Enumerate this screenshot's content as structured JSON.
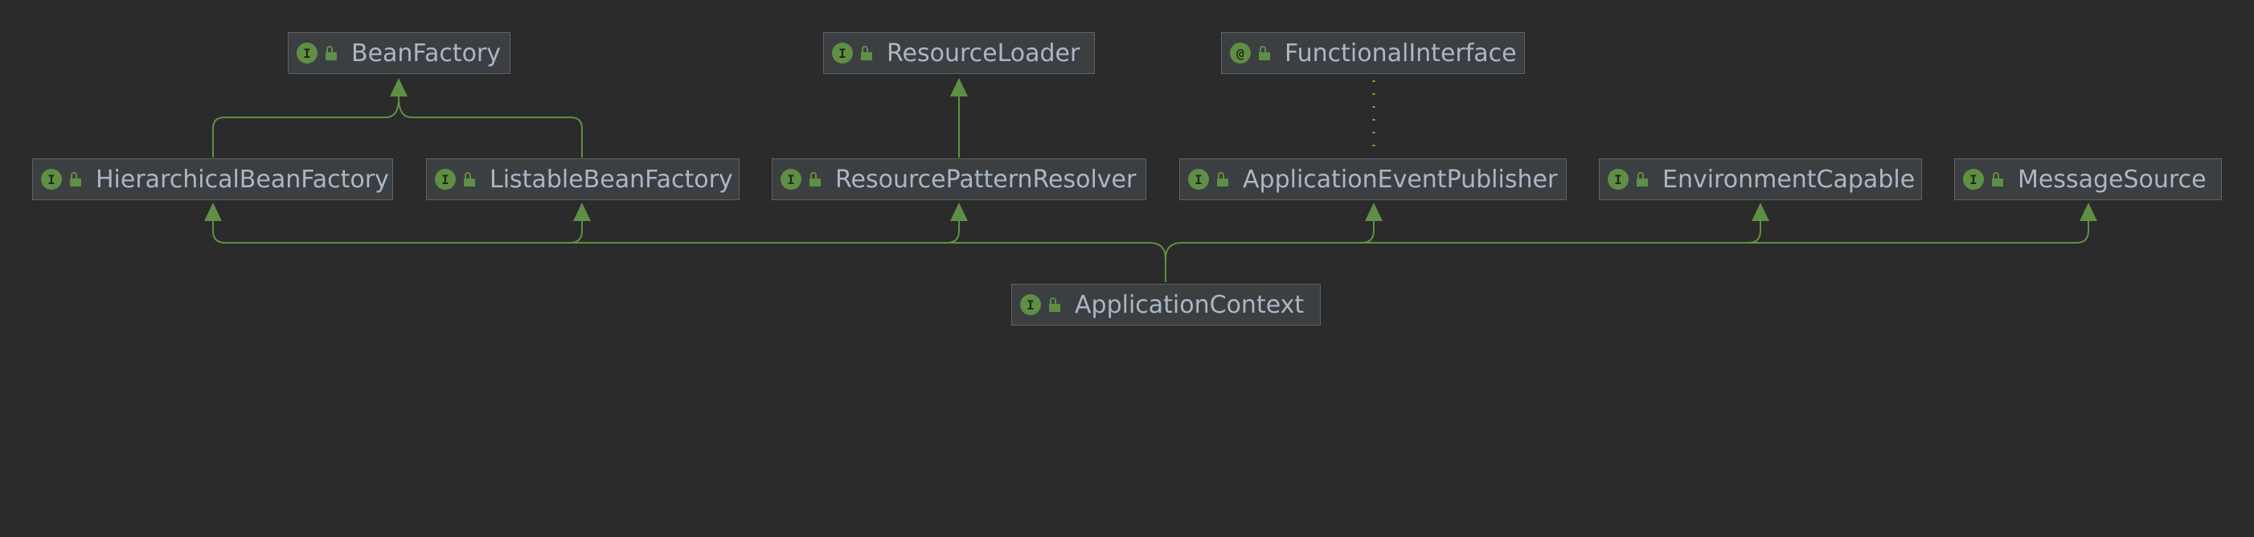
{
  "diagram": {
    "nodes": [
      {
        "id": "bean-factory",
        "badge": "I",
        "label": "BeanFactory"
      },
      {
        "id": "resource-loader",
        "badge": "I",
        "label": "ResourceLoader"
      },
      {
        "id": "functional-interface",
        "badge": "@",
        "label": "FunctionalInterface"
      },
      {
        "id": "hierarchical-bean-factory",
        "badge": "I",
        "label": "HierarchicalBeanFactory"
      },
      {
        "id": "listable-bean-factory",
        "badge": "I",
        "label": "ListableBeanFactory"
      },
      {
        "id": "resource-pattern-resolver",
        "badge": "I",
        "label": "ResourcePatternResolver"
      },
      {
        "id": "application-event-publisher",
        "badge": "I",
        "label": "ApplicationEventPublisher"
      },
      {
        "id": "environment-capable",
        "badge": "I",
        "label": "EnvironmentCapable"
      },
      {
        "id": "message-source",
        "badge": "I",
        "label": "MessageSource"
      },
      {
        "id": "application-context",
        "badge": "I",
        "label": "ApplicationContext"
      }
    ],
    "edges": [
      {
        "from": "hierarchical-bean-factory",
        "to": "bean-factory",
        "kind": "extends"
      },
      {
        "from": "listable-bean-factory",
        "to": "bean-factory",
        "kind": "extends"
      },
      {
        "from": "resource-pattern-resolver",
        "to": "resource-loader",
        "kind": "extends"
      },
      {
        "from": "application-event-publisher",
        "to": "functional-interface",
        "kind": "annotated"
      },
      {
        "from": "application-context",
        "to": "hierarchical-bean-factory",
        "kind": "extends"
      },
      {
        "from": "application-context",
        "to": "listable-bean-factory",
        "kind": "extends"
      },
      {
        "from": "application-context",
        "to": "resource-pattern-resolver",
        "kind": "extends"
      },
      {
        "from": "application-context",
        "to": "application-event-publisher",
        "kind": "extends"
      },
      {
        "from": "application-context",
        "to": "environment-capable",
        "kind": "extends"
      },
      {
        "from": "application-context",
        "to": "message-source",
        "kind": "extends"
      }
    ],
    "colors": {
      "background": "#2b2b2b",
      "node_fill": "#3c3f41",
      "node_border": "#5f6265",
      "text": "#a9b7c6",
      "edge": "#5f8f44",
      "annotation_edge": "#9aa82e"
    }
  }
}
